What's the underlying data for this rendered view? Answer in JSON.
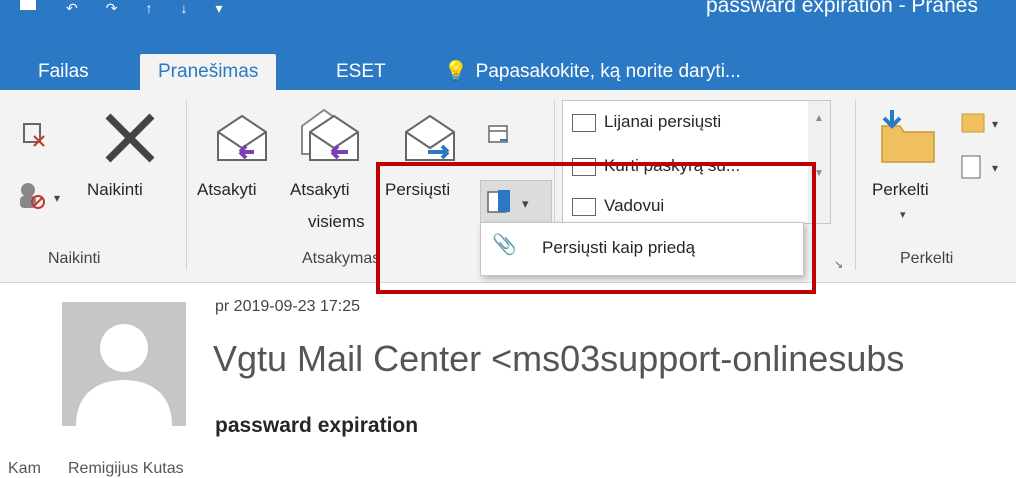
{
  "window": {
    "title": "passward expiration - Praneš"
  },
  "tabs": [
    {
      "label": "Failas"
    },
    {
      "label": "Pranešimas"
    },
    {
      "label": "ESET"
    }
  ],
  "tell_me": {
    "placeholder": "Papasakokite, ką norite daryti..."
  },
  "ribbon": {
    "delete_group": {
      "delete_label": "Naikinti",
      "group_label": "Naikinti"
    },
    "respond_group": {
      "reply_label": "Atsakyti",
      "reply_all_line1": "Atsakyti",
      "reply_all_line2": "visiems",
      "forward_label": "Persiųsti",
      "group_label": "Atsakymas"
    },
    "quick_steps": {
      "items": [
        {
          "label": "Lijanai persiųsti"
        },
        {
          "label": "Kurti paskyrą su..."
        },
        {
          "label": "Vadovui"
        }
      ]
    },
    "move_group": {
      "move_label": "Perkelti",
      "group_label": "Perkelti"
    },
    "forward_dropdown": {
      "item_label": "Persiųsti kaip priedą"
    }
  },
  "message": {
    "sent": "pr 2019-09-23 17:25",
    "sender": "Vgtu Mail Center <ms03support-onlinesubs",
    "subject": "passward expiration",
    "to_label": "Kam",
    "to_value": "Remigijus Kutas"
  },
  "colors": {
    "accent": "#2b79c4",
    "highlight": "#c00000"
  }
}
